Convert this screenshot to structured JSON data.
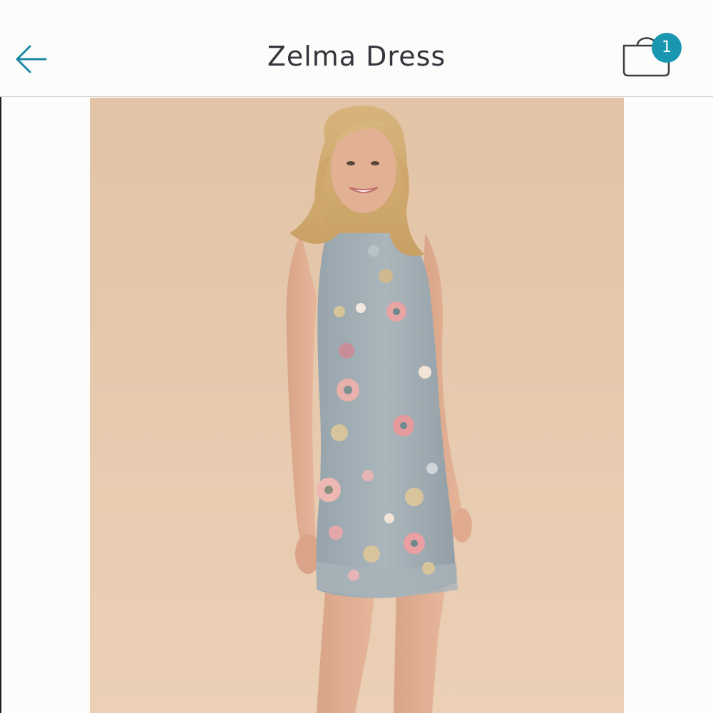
{
  "header": {
    "title": "Zelma Dress",
    "back_icon": "arrow-left-icon",
    "cart_icon": "shopping-bag-icon",
    "cart_count": "1"
  },
  "product": {
    "image_description": "model-wearing-grey-floral-beaded-sheath-dress"
  },
  "colors": {
    "accent": "#1a97b0",
    "title_text": "#33363c",
    "background": "#fcfcfa",
    "photo_backdrop": "#e7c9ad",
    "dress": "#a3afb5"
  }
}
